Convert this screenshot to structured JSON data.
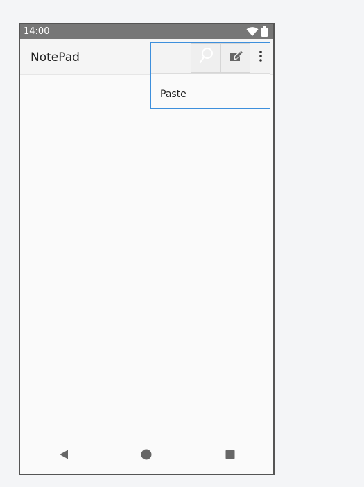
{
  "status_bar": {
    "time": "14:00",
    "icons": [
      "wifi-icon",
      "battery-icon"
    ]
  },
  "app_bar": {
    "title": "NotePad",
    "actions": [
      {
        "name": "search",
        "icon": "search-icon"
      },
      {
        "name": "compose",
        "icon": "edit-note-icon"
      },
      {
        "name": "more",
        "icon": "more-vert-icon"
      }
    ]
  },
  "overflow_menu": {
    "items": [
      {
        "label": "Paste"
      }
    ]
  },
  "navigation_bar": {
    "buttons": [
      {
        "name": "back",
        "icon": "back-triangle-icon"
      },
      {
        "name": "home",
        "icon": "home-circle-icon"
      },
      {
        "name": "recents",
        "icon": "recents-square-icon"
      }
    ]
  },
  "colors": {
    "status_bar": "#777777",
    "selection_outline": "#3d8fdc",
    "background": "#fafafa",
    "icon": "#666666"
  }
}
